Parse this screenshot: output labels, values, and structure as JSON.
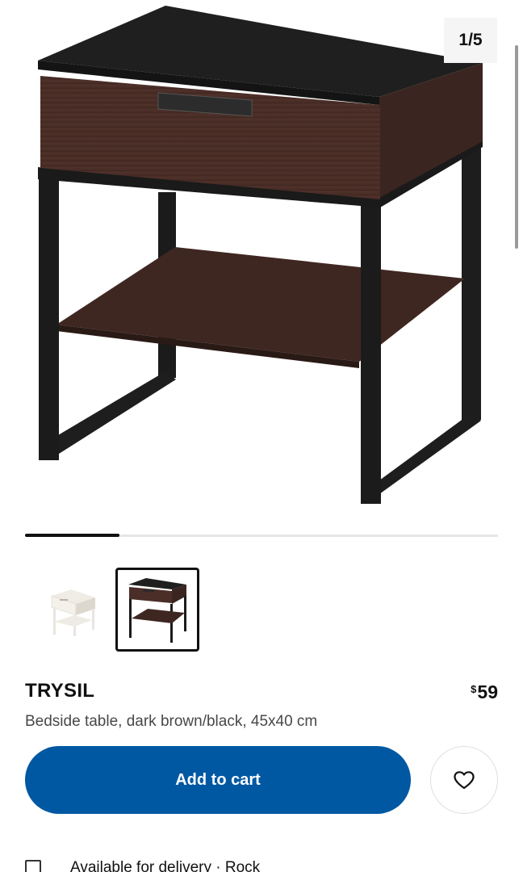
{
  "gallery": {
    "counter": "1/5",
    "progress_fraction": 0.2,
    "main_image": "trysil-bedside-table-dark-brown-black",
    "thumbnails": [
      {
        "name": "white-variant",
        "selected": false
      },
      {
        "name": "dark-brown-black-variant",
        "selected": true
      }
    ]
  },
  "product": {
    "name": "TRYSIL",
    "currency_symbol": "$",
    "price": "59",
    "description": "Bedside table, dark brown/black, 45x40 cm"
  },
  "actions": {
    "add_to_cart_label": "Add to cart",
    "favorite_icon": "heart-icon"
  },
  "delivery": {
    "icon": "checkbox-icon",
    "text": "Available for delivery · Rock"
  },
  "colors": {
    "primary_button": "#0058a3",
    "wood": "#4a2e27",
    "frame": "#1c1c1c"
  }
}
